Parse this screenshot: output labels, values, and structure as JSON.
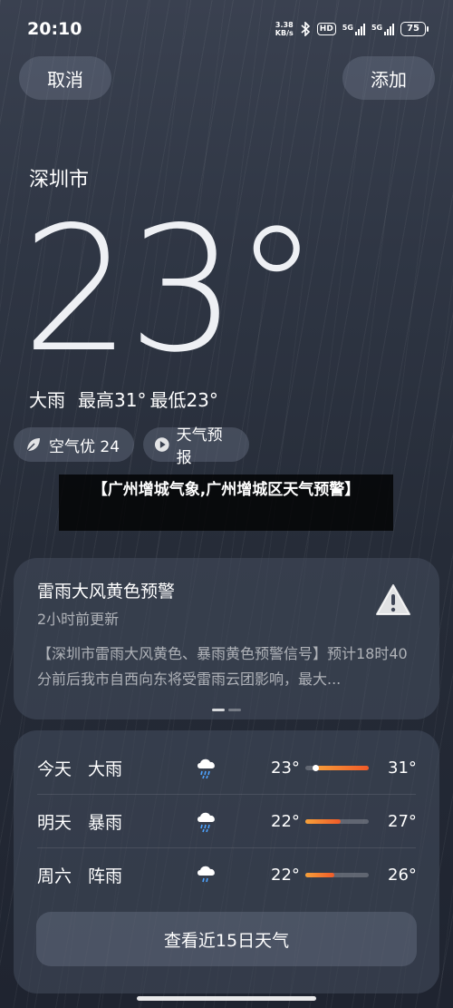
{
  "status_bar": {
    "time": "20:10",
    "net_speed_value": "3.38",
    "net_speed_unit": "KB/s",
    "hd_badge": "HD",
    "signal1_label": "5G",
    "signal2_label": "5G",
    "battery": "75"
  },
  "header": {
    "cancel_label": "取消",
    "add_label": "添加"
  },
  "current": {
    "city": "深圳市",
    "temperature": "23°",
    "condition": "大雨",
    "high": "最高31°",
    "low": "最低23°"
  },
  "chips": {
    "air_quality": "空气优 24",
    "forecast": "天气预报"
  },
  "overlay": {
    "title": "【广州增城气象,广州增城区天气预警】"
  },
  "alert": {
    "title": "雷雨大风黄色预警",
    "updated": "2小时前更新",
    "body": "【深圳市雷雨大风黄色、暴雨黄色预警信号】预计18时40分前后我市自西向东将受雷雨云团影响，最大..."
  },
  "forecast": {
    "rows": [
      {
        "day": "今天",
        "condition": "大雨",
        "low": "23°",
        "high": "31°",
        "icon": "rain-icon",
        "range_start": 0.12,
        "range_end": 1.0
      },
      {
        "day": "明天",
        "condition": "暴雨",
        "low": "22°",
        "high": "27°",
        "icon": "rain-icon",
        "range_start": 0.0,
        "range_end": 0.55
      },
      {
        "day": "周六",
        "condition": "阵雨",
        "low": "22°",
        "high": "26°",
        "icon": "rain-icon",
        "range_start": 0.0,
        "range_end": 0.45
      }
    ],
    "more_label": "查看近15日天气"
  },
  "colors": {
    "range_bar_start": "#f7a13a",
    "range_bar_end": "#f05a28",
    "rain_drop": "#4da3ff"
  }
}
